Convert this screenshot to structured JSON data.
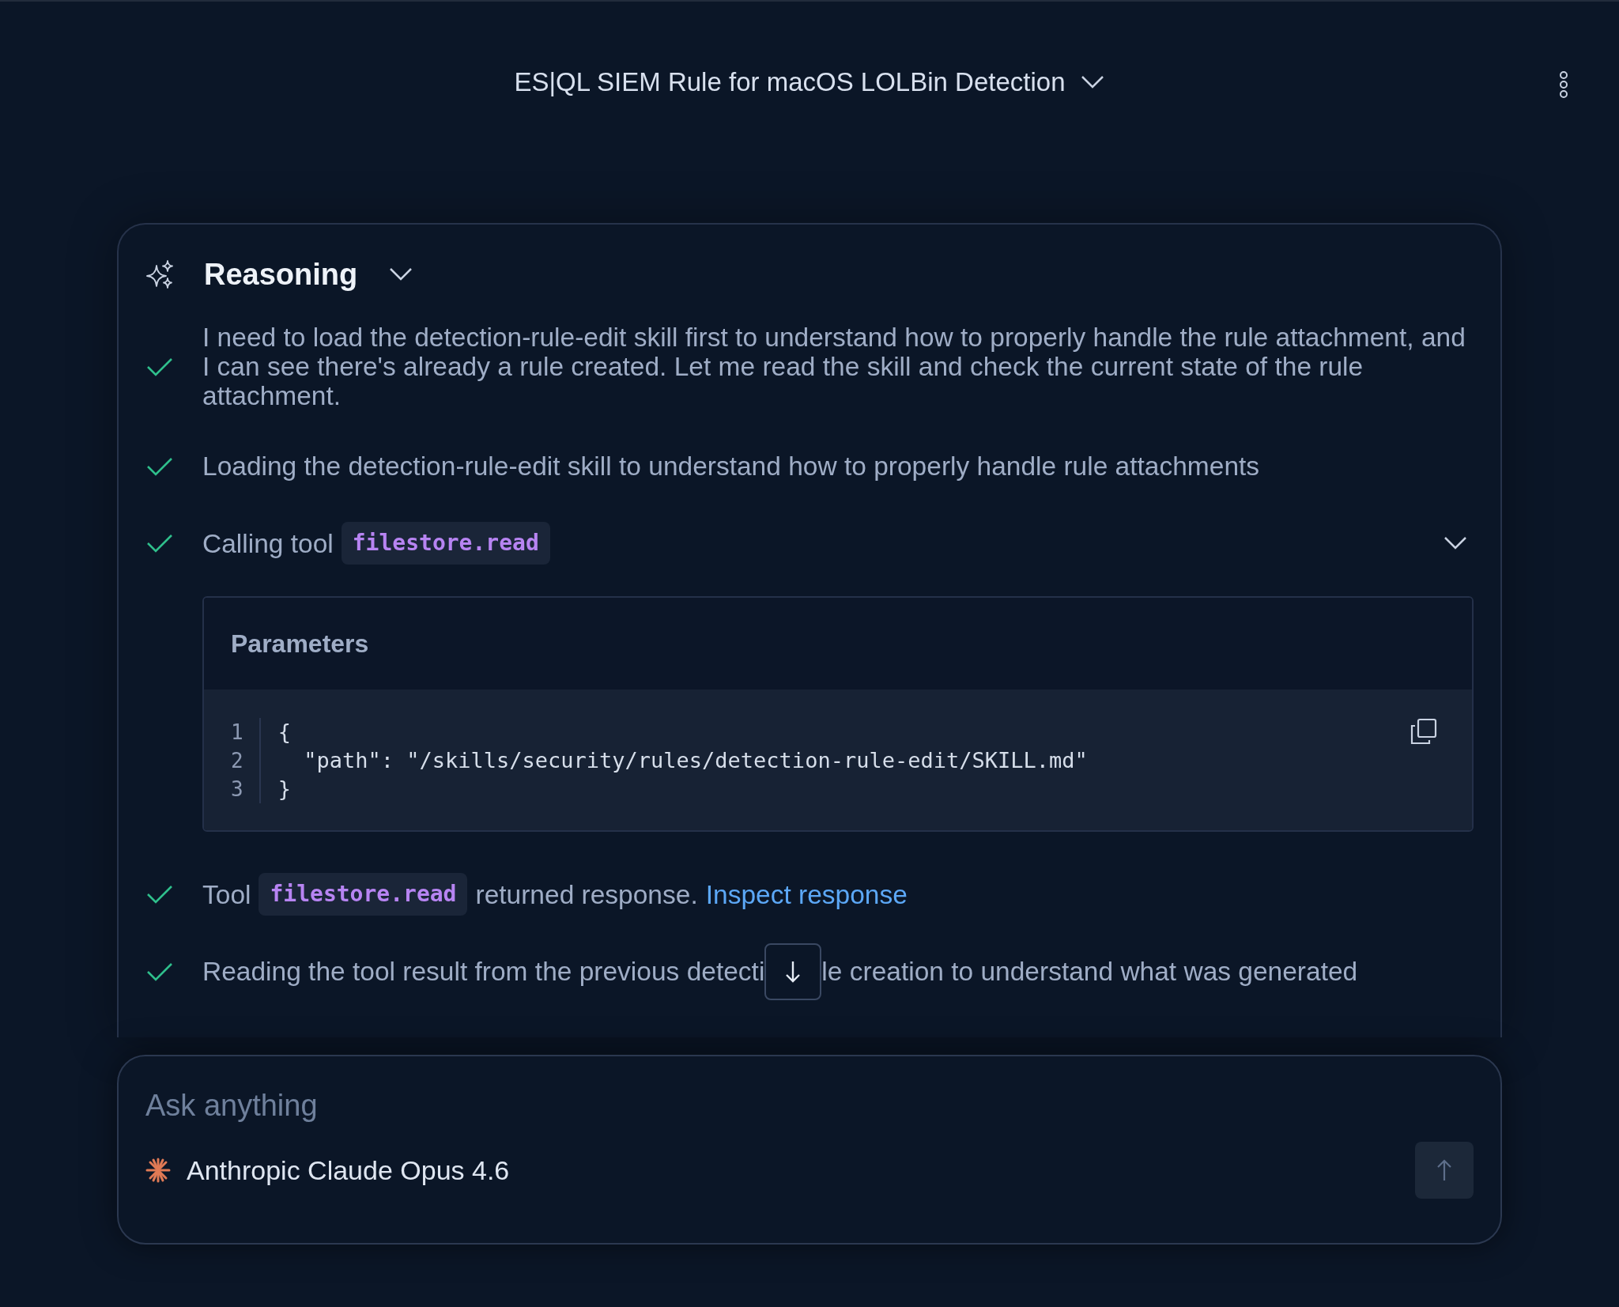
{
  "header": {
    "title": "ES|QL SIEM Rule for macOS LOLBin Detection"
  },
  "reasoning": {
    "title": "Reasoning",
    "expanded": true,
    "steps": [
      {
        "kind": "text",
        "done": true,
        "text": "I need to load the detection-rule-edit skill first to understand how to properly handle the rule attachment, and I can see there's already a rule created. Let me read the skill and check the current state of the rule attachment."
      },
      {
        "kind": "text",
        "done": true,
        "text": "Loading the detection-rule-edit skill to understand how to properly handle rule attachments"
      },
      {
        "kind": "tool_call",
        "done": true,
        "label": "Calling tool",
        "tool": "filestore.read",
        "expanded": true,
        "parameters": {
          "title": "Parameters",
          "lines": [
            {
              "number": "1",
              "code": "{"
            },
            {
              "number": "2",
              "code": "  \"path\": \"/skills/security/rules/detection-rule-edit/SKILL.md\""
            },
            {
              "number": "3",
              "code": "}"
            }
          ]
        }
      },
      {
        "kind": "tool_response",
        "done": true,
        "label": "Tool",
        "tool": "filestore.read",
        "suffix": "returned response.",
        "link": "Inspect response"
      },
      {
        "kind": "covered_text",
        "done": true,
        "before": "Reading the tool result from the previous detecti",
        "after": "le creation to understand what was generated"
      }
    ]
  },
  "composer": {
    "placeholder": "Ask anything",
    "model": "Anthropic Claude Opus 4.6"
  }
}
